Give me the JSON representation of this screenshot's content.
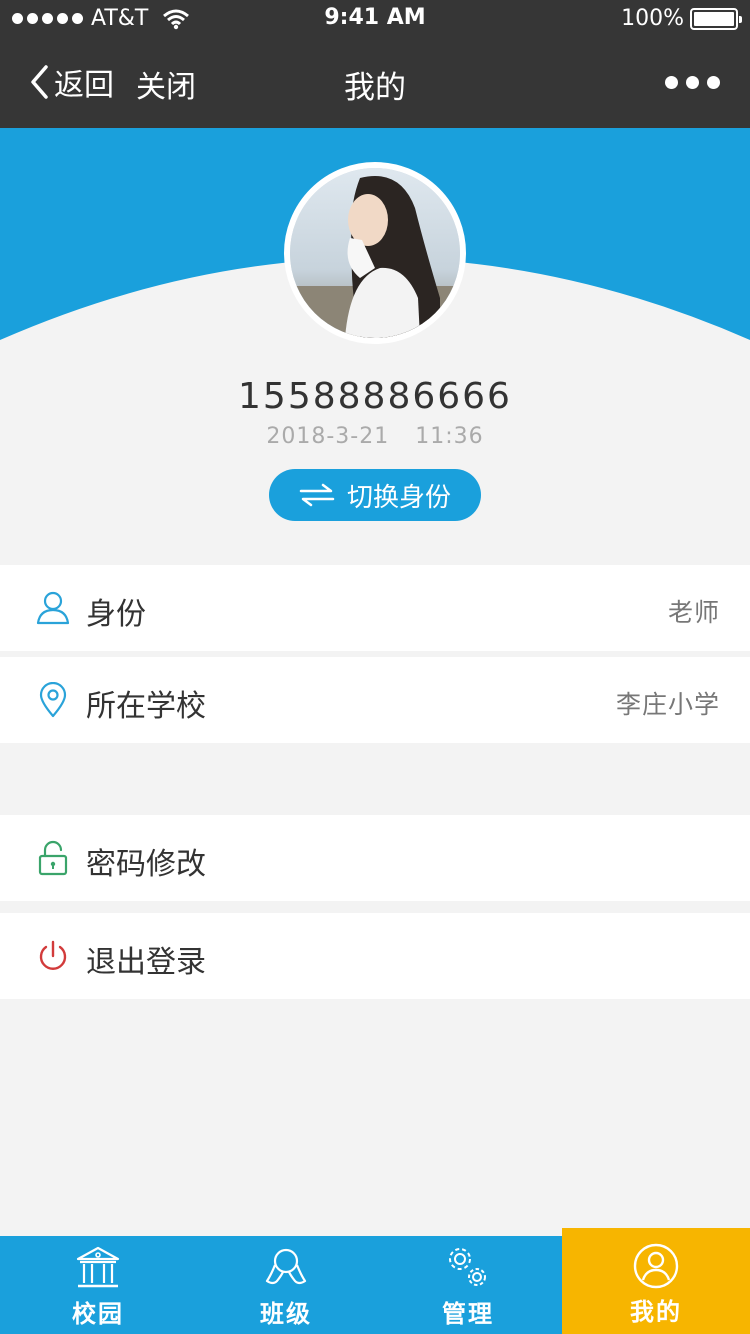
{
  "status_bar": {
    "carrier": "AT&T",
    "time": "9:41 AM",
    "battery": "100%",
    "battery_level": 1.0
  },
  "nav": {
    "back_label": "返回",
    "close_label": "关闭",
    "title": "我的"
  },
  "profile": {
    "phone": "15588886666",
    "login_time": "2018-3-21 11:36",
    "switch_label": "切换身份"
  },
  "rows": [
    {
      "label": "身份",
      "value": "老师",
      "icon": "person-icon"
    },
    {
      "label": "所在学校",
      "value": "李庄小学",
      "icon": "location-pin-icon"
    },
    {
      "label": "密码修改",
      "icon": "lock-icon"
    },
    {
      "label": "退出登录",
      "icon": "power-icon"
    }
  ],
  "tabs": [
    {
      "label": "校园",
      "icon": "campus-icon"
    },
    {
      "label": "班级",
      "icon": "class-icon"
    },
    {
      "label": "管理",
      "icon": "gears-icon"
    },
    {
      "label": "我的",
      "icon": "user-circle-icon",
      "active": true
    }
  ],
  "colors": {
    "primary": "#1aa0dc",
    "active_tab": "#f7b500",
    "nav_bg": "#363636",
    "page_bg": "#f3f3f3"
  }
}
